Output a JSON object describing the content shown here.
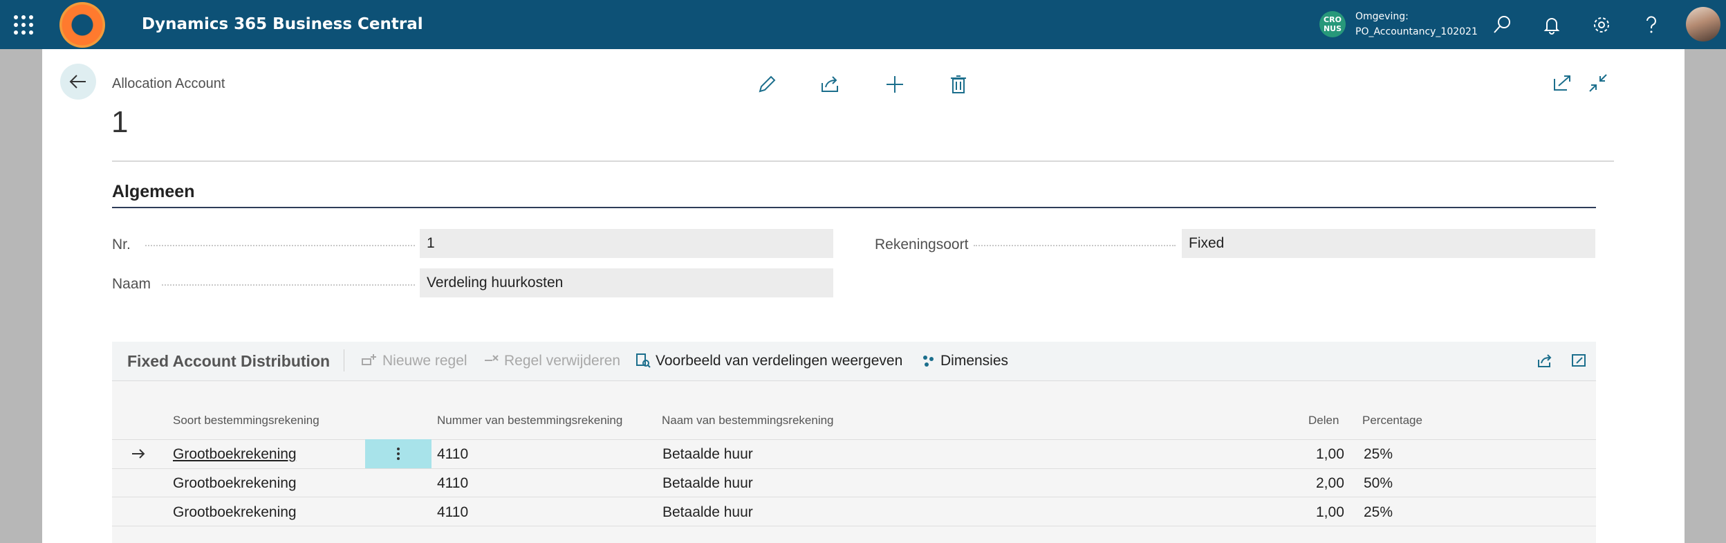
{
  "app": {
    "title": "Dynamics 365 Business Central",
    "environment_badge": "CRO NUS",
    "environment_label": "Omgeving:",
    "environment_name": "PO_Accountancy_102021",
    "icons": [
      "app-launcher-icon",
      "search-icon",
      "bell-icon",
      "gear-icon",
      "help-icon",
      "avatar"
    ]
  },
  "page": {
    "breadcrumb": "Allocation Account",
    "record_number": "1",
    "actions": [
      "edit-icon",
      "share-icon",
      "add-icon",
      "delete-icon"
    ],
    "window_actions": [
      "open-new-window-icon",
      "collapse-icon"
    ]
  },
  "general": {
    "title": "Algemeen",
    "nr_label": "Nr.",
    "nr_value": "1",
    "naam_label": "Naam",
    "naam_value": "Verdeling huurkosten",
    "rekeningsoort_label": "Rekeningsoort",
    "rekeningsoort_value": "Fixed"
  },
  "distribution": {
    "title": "Fixed Account Distribution",
    "actions": {
      "new_line": "Nieuwe regel",
      "delete_line": "Regel verwijderen",
      "preview": "Voorbeeld van verdelingen weergeven",
      "dimensions": "Dimensies"
    },
    "columns": {
      "soort": "Soort bestemmingsrekening",
      "nummer": "Nummer van bestemmingsrekening",
      "naam": "Naam van bestemmingsrekening",
      "delen": "Delen",
      "percentage": "Percentage"
    },
    "rows": [
      {
        "soort": "Grootboekrekening",
        "nummer": "4110",
        "naam": "Betaalde huur",
        "delen": "1,00",
        "percentage": "25%"
      },
      {
        "soort": "Grootboekrekening",
        "nummer": "4110",
        "naam": "Betaalde huur",
        "delen": "2,00",
        "percentage": "50%"
      },
      {
        "soort": "Grootboekrekening",
        "nummer": "4110",
        "naam": "Betaalde huur",
        "delen": "1,00",
        "percentage": "25%"
      }
    ]
  },
  "colors": {
    "topbar": "#0d5176",
    "accent": "#1b6e8c",
    "env_badge": "#27987a",
    "section_rule": "#2e3c58",
    "selected_cell": "#a8e3ea"
  }
}
